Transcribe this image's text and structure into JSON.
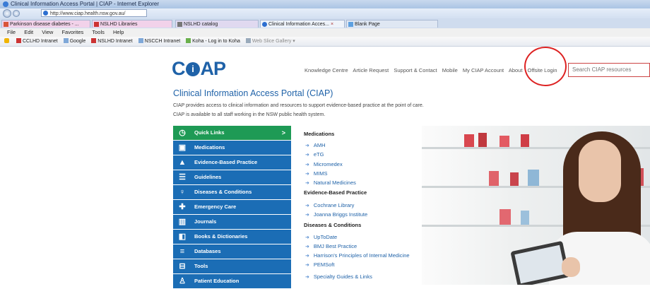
{
  "browser": {
    "title": "Clinical Information Access Portal | CIAP - Internet Explorer",
    "url": "http://www.ciap.health.nsw.gov.au/",
    "tabs": [
      {
        "label": "Parkinson disease diabetes - ..."
      },
      {
        "label": "NSLHD Libraries"
      },
      {
        "label": "NSLHD catalog"
      },
      {
        "label": "Clinical Information Acces...",
        "close": "×"
      },
      {
        "label": "Blank Page"
      }
    ],
    "menu": [
      "File",
      "Edit",
      "View",
      "Favorites",
      "Tools",
      "Help"
    ],
    "favorites": [
      "CCLHD Intranet",
      "Google",
      "NSLHD Intranet",
      "NSCCH Intranet",
      "Koha - Log in to Koha",
      "Web Slice Gallery ▾"
    ]
  },
  "site": {
    "logo": {
      "pre": "C",
      "mid": "i",
      "post": "AP"
    },
    "nav": [
      "Knowledge Centre",
      "Article Request",
      "Support & Contact",
      "Mobile",
      "My CIAP Account",
      "About",
      "Offsite Login"
    ],
    "search_placeholder": "Search CIAP resources",
    "page_title": "Clinical Information Access Portal (CIAP)",
    "intro1": "CIAP provides access to clinical information and resources to support evidence-based practice at the point of care.",
    "intro2": "CIAP is available to all staff working in the NSW public health system."
  },
  "sidebar": {
    "items": [
      {
        "label": "Quick Links",
        "icon": "clock-icon",
        "arrow": ">"
      },
      {
        "label": "Medications",
        "icon": "pill-box-icon"
      },
      {
        "label": "Evidence-Based Practice",
        "icon": "triangle-icon"
      },
      {
        "label": "Guidelines",
        "icon": "checklist-icon"
      },
      {
        "label": "Diseases & Conditions",
        "icon": "stethoscope-icon"
      },
      {
        "label": "Emergency Care",
        "icon": "medical-cross-icon"
      },
      {
        "label": "Journals",
        "icon": "open-book-icon"
      },
      {
        "label": "Books & Dictionaries",
        "icon": "book-icon"
      },
      {
        "label": "Databases",
        "icon": "database-icon"
      },
      {
        "label": "Tools",
        "icon": "toolbox-icon"
      },
      {
        "label": "Patient Education",
        "icon": "person-icon"
      }
    ]
  },
  "quicklinks": {
    "sections": [
      {
        "title": "Medications",
        "links": [
          "AMH",
          "eTG",
          "Micromedex",
          "MIMS",
          "Natural Medicines"
        ]
      },
      {
        "title": "Evidence-Based Practice",
        "links": [
          "Cochrane Library",
          "Joanna Briggs Institute"
        ]
      },
      {
        "title": "Diseases & Conditions",
        "links": [
          "UpToDate",
          "BMJ Best Practice",
          "Harrison's Principles of Internal Medicine",
          "PEMSoft"
        ]
      }
    ],
    "extra": "Specialty Guides & Links",
    "arrow": "➜"
  },
  "colors": {
    "brand": "#1f62a8",
    "sidebar": "#1b6db5",
    "quicklinks": "#1e9a55",
    "annotation": "#dd2222"
  }
}
